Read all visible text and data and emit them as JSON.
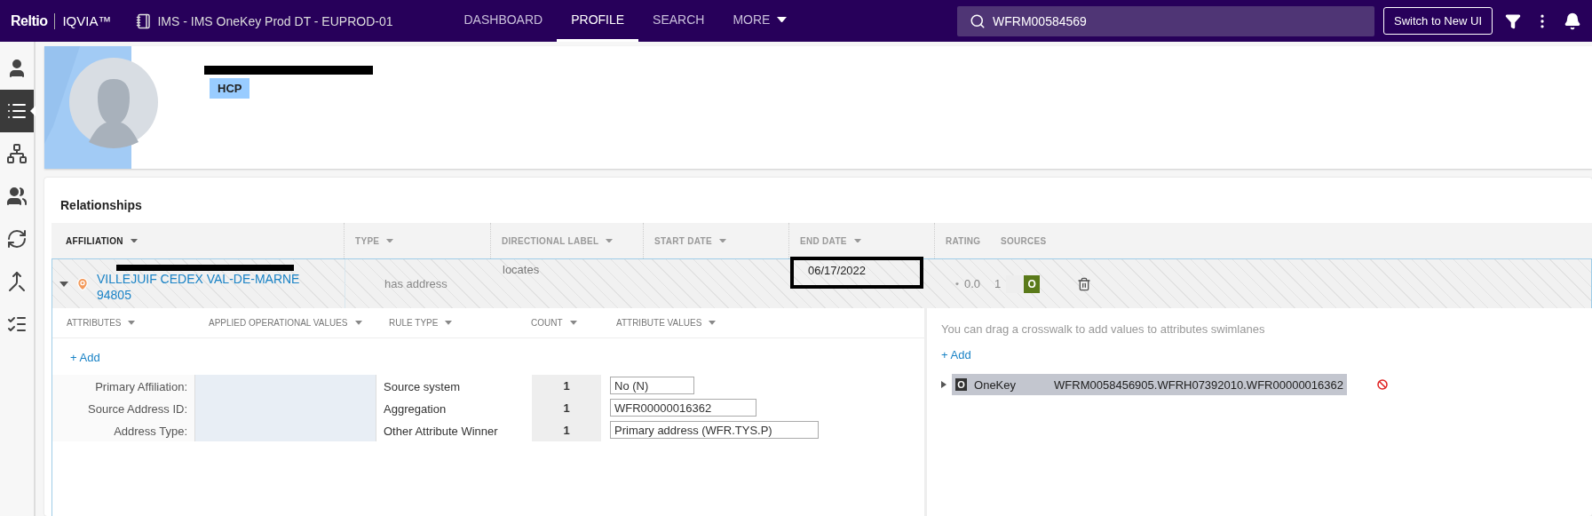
{
  "topbar": {
    "logo": "Reltio",
    "brand": "IQVIA™",
    "tenant": "IMS - IMS OneKey Prod DT - EUPROD-01",
    "nav": [
      {
        "label": "DASHBOARD",
        "selected": false,
        "has_menu": false
      },
      {
        "label": "PROFILE",
        "selected": true,
        "has_menu": false
      },
      {
        "label": "SEARCH",
        "selected": false,
        "has_menu": false
      },
      {
        "label": "MORE",
        "selected": false,
        "has_menu": true
      }
    ],
    "search": {
      "value": "WFRM00584569"
    },
    "switch_button": "Switch to New UI"
  },
  "sidebar": {
    "items": [
      {
        "selected": false
      },
      {
        "selected": true
      },
      {
        "selected": false
      },
      {
        "selected": false
      },
      {
        "selected": false
      },
      {
        "selected": false
      },
      {
        "selected": false
      }
    ]
  },
  "profile": {
    "name_redacted": true,
    "badge": "HCP"
  },
  "relationships": {
    "title": "Relationships",
    "columns": [
      {
        "label": "AFFILIATION",
        "selected": true,
        "has_menu": true
      },
      {
        "label": "TYPE",
        "selected": false,
        "has_menu": true
      },
      {
        "label": "DIRECTIONAL LABEL",
        "selected": false,
        "has_menu": true
      },
      {
        "label": "START DATE",
        "selected": false,
        "has_menu": true
      },
      {
        "label": "END DATE",
        "selected": false,
        "has_menu": true
      },
      {
        "label": "RATING",
        "selected": false,
        "has_menu": false
      },
      {
        "label": "SOURCES",
        "selected": false,
        "has_menu": false
      }
    ],
    "row": {
      "expanded": true,
      "address_redacted": true,
      "affiliation": "VILLEJUIF CEDEX VAL-DE-MARNE 94805",
      "type": "has address",
      "directional_label": "locates",
      "end_date": "06/17/2022",
      "end_date_highlighted": true,
      "rating": "0.0",
      "source_count": "1",
      "source_badge": "O"
    },
    "attributes": {
      "columns": [
        {
          "label": "ATTRIBUTES"
        },
        {
          "label": "APPLIED OPERATIONAL VALUES"
        },
        {
          "label": "RULE TYPE"
        },
        {
          "label": "COUNT"
        },
        {
          "label": "ATTRIBUTE VALUES"
        }
      ],
      "add_label": "+ Add",
      "rows": [
        {
          "label": "Primary Affiliation:",
          "rule_type": "Source system",
          "count": "1",
          "value": "No (N)"
        },
        {
          "label": "Source Address ID:",
          "rule_type": "Aggregation",
          "count": "1",
          "value": "WFR00000016362"
        },
        {
          "label": "Address Type:",
          "rule_type": "Other Attribute Winner",
          "count": "1",
          "value": "Primary address (WFR.TYS.P)"
        }
      ]
    },
    "crosswalks": {
      "hint": "You can drag a crosswalk to add values to attributes swimlanes",
      "add_label": "+ Add",
      "items": [
        {
          "badge": "O",
          "source": "OneKey",
          "value": "WFRM0058456905.WFRH07392010.WFR00000016362"
        }
      ]
    }
  }
}
